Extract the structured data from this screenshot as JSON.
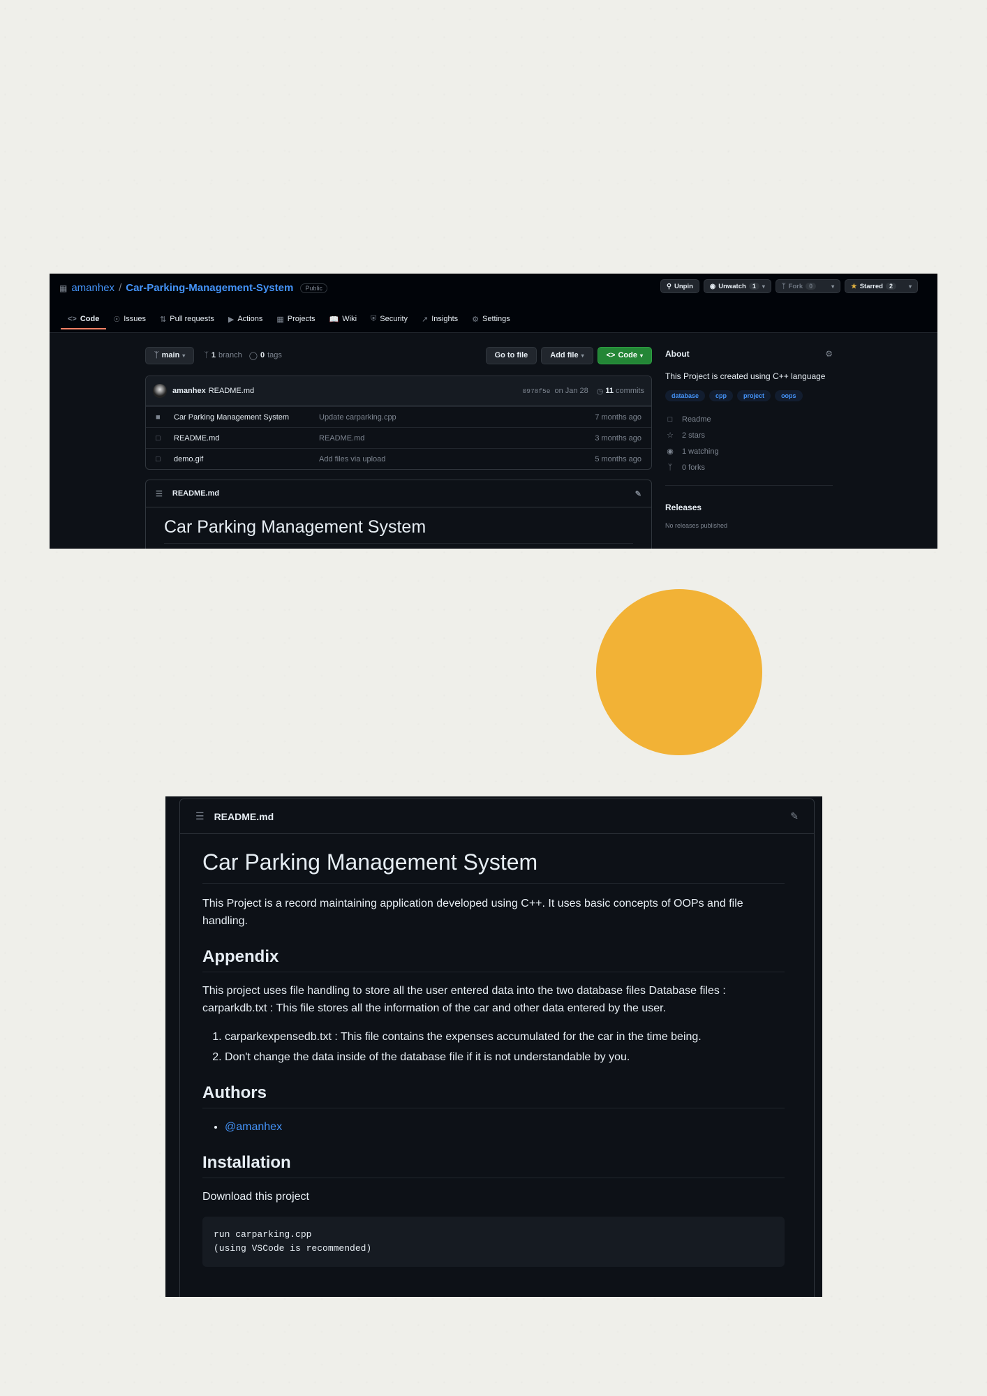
{
  "repo": {
    "owner": "amanhex",
    "slash": "/",
    "name": "Car-Parking-Management-System",
    "visibility": "Public",
    "unpin": "Unpin",
    "unwatch": "Unwatch",
    "watch_count": "1",
    "fork": "Fork",
    "fork_count": "0",
    "starred": "Starred",
    "star_count": "2"
  },
  "tabs": [
    "Code",
    "Issues",
    "Pull requests",
    "Actions",
    "Projects",
    "Wiki",
    "Security",
    "Insights",
    "Settings"
  ],
  "branch": {
    "name": "main",
    "branch_count": "1",
    "branch_label": "branch",
    "tag_count": "0",
    "tag_label": "tags",
    "go_to_file": "Go to file",
    "add_file": "Add file",
    "code": "Code"
  },
  "commit": {
    "author": "amanhex",
    "message": "README.md",
    "hash": "0978f5e",
    "date": "on Jan 28",
    "count": "11",
    "count_label": "commits"
  },
  "files": [
    {
      "name": "Car Parking Management System",
      "message": "Update carparking.cpp",
      "age": "7 months ago",
      "type": "folder"
    },
    {
      "name": "README.md",
      "message": "README.md",
      "age": "3 months ago",
      "type": "file"
    },
    {
      "name": "demo.gif",
      "message": "Add files via upload",
      "age": "5 months ago",
      "type": "file"
    }
  ],
  "readme_small": {
    "filename": "README.md",
    "title": "Car Parking Management System"
  },
  "about": {
    "heading": "About",
    "description": "This Project is created using C++ language",
    "topics": [
      "database",
      "cpp",
      "project",
      "oops"
    ],
    "readme": "Readme",
    "stars": "2 stars",
    "watching": "1 watching",
    "forks": "0 forks",
    "releases": "Releases",
    "no_releases": "No releases published"
  },
  "accent_color": "#f2b236",
  "readme": {
    "filename": "README.md",
    "title": "Car Parking Management System",
    "intro": "This Project is a record maintaining application developed using C++. It uses basic concepts of OOPs and file handling.",
    "appendix_heading": "Appendix",
    "appendix_text": "This project uses file handling to store all the user entered data into the two database files Database files : carparkdb.txt : This file stores all the information of the car and other data entered by the user.",
    "appendix_items": [
      "carparkexpensedb.txt : This file contains the expenses accumulated for the car in the time being.",
      "Don't change the data inside of the database file if it is not understandable by you."
    ],
    "authors_heading": "Authors",
    "author_link": "@amanhex",
    "installation_heading": "Installation",
    "installation_text": "Download this project",
    "code_line1": "run carparking.cpp",
    "code_line2": "(using VSCode is recommended)"
  }
}
